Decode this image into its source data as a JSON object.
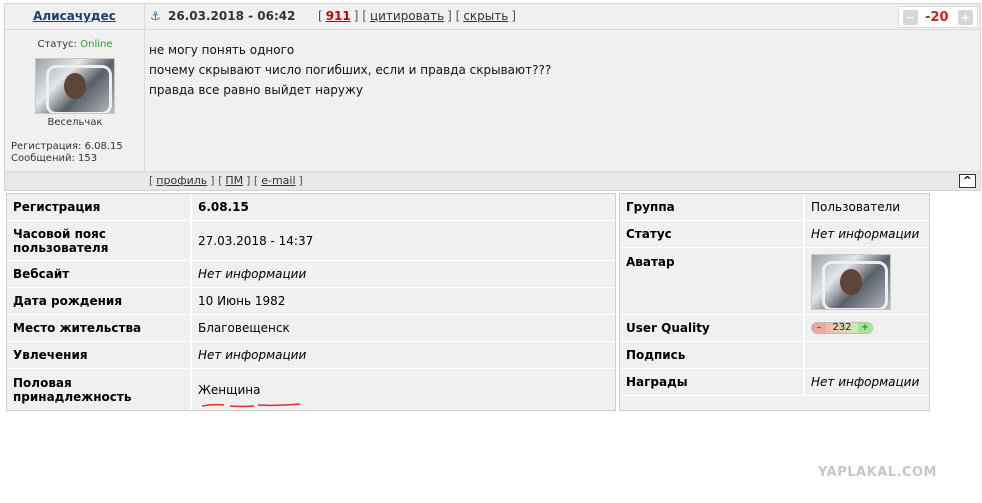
{
  "post": {
    "author": "Алисачудес",
    "datetime": "26.03.2018 - 06:42",
    "reply_count": "911",
    "quote_label": "цитировать",
    "hide_label": "скрыть",
    "rating": "-20",
    "status_label": "Статус:",
    "status_value": "Online",
    "rank": "Весельчак",
    "registration": "Регистрация: 6.08.15",
    "messages": "Сообщений: 153",
    "lines": [
      "не могу понять одного",
      "почему скрывают число погибших, если и правда скрывают???",
      "правда все равно выйдет наружу"
    ],
    "footer": {
      "profile_label": "профиль",
      "pm_label": "ПМ",
      "email_label": "e-mail",
      "top_label": "^"
    }
  },
  "profile_left": [
    {
      "key": "Регистрация",
      "value": "6.08.15",
      "style": "bold"
    },
    {
      "key": "Часовой пояс пользователя",
      "value": "27.03.2018 - 14:37",
      "style": "normal"
    },
    {
      "key": "Вебсайт",
      "value": "Нет информации",
      "style": "italic"
    },
    {
      "key": "Дата рождения",
      "value": "10 Июнь 1982",
      "style": "normal"
    },
    {
      "key": "Место жительства",
      "value": "Благовещенск",
      "style": "normal"
    },
    {
      "key": "Увлечения",
      "value": "Нет информации",
      "style": "italic"
    },
    {
      "key": "Половая принадлежность",
      "value": "Женщина",
      "style": "normal"
    }
  ],
  "profile_right": {
    "group_key": "Группа",
    "group_value": "Пользователи",
    "status_key": "Статус",
    "status_value": "Нет информации",
    "avatar_key": "Аватар",
    "quality_key": "User Quality",
    "quality_value": "232",
    "signature_key": "Подпись",
    "signature_value": "",
    "awards_key": "Награды",
    "awards_value": "Нет информации"
  },
  "colors": {
    "author": "#1d3d6d",
    "rating_negative": "#cc1f1f",
    "online": "#22a122",
    "underline_mark": "#e03030"
  },
  "icons": [
    "anchor-icon",
    "vote-down-icon",
    "vote-up-icon"
  ],
  "watermark": "YAPLAKAL.COM"
}
